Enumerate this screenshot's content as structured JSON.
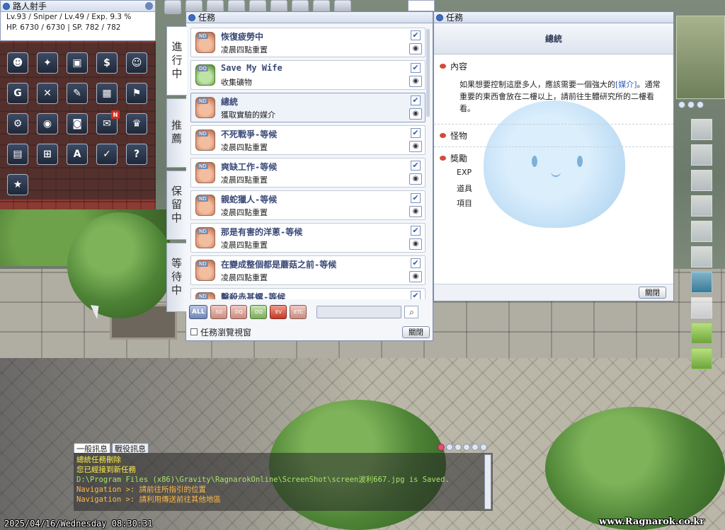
{
  "character": {
    "name": "路人射手",
    "stats_line1": "Lv.93 / Sniper / Lv.49 / Exp. 9.3 %",
    "stats_line2": "HP. 6730 / 6730 | SP. 782 / 782"
  },
  "menu": {
    "mail_badge": "N",
    "text_icon": "A",
    "items": [
      {
        "icon": "character-status-icon"
      },
      {
        "icon": "skill-tree-icon"
      },
      {
        "icon": "inventory-icon"
      },
      {
        "icon": "cash-shop-icon"
      },
      {
        "icon": "friend-add-icon"
      },
      {
        "icon": "guild-icon"
      },
      {
        "icon": "battle-icon"
      },
      {
        "icon": "quest-scroll-icon"
      },
      {
        "icon": "world-map-icon"
      },
      {
        "icon": "flag-icon"
      },
      {
        "icon": "settings-icon"
      },
      {
        "icon": "storage-bag-icon"
      },
      {
        "icon": "camera-icon"
      },
      {
        "icon": "mail-icon"
      },
      {
        "icon": "trophy-icon"
      },
      {
        "icon": "book-icon"
      },
      {
        "icon": "shop-cart-icon"
      },
      {
        "icon": "text-a-icon"
      },
      {
        "icon": "calendar-icon"
      },
      {
        "icon": "help-icon"
      },
      {
        "icon": "party-icon"
      }
    ]
  },
  "quest_window": {
    "title": "任務",
    "tabs": [
      "進行中",
      "推薦",
      "保留中",
      "等待中"
    ],
    "items": [
      {
        "type": "ND",
        "name": "恢復疲勞中",
        "sub": "凌晨四點重置",
        "checked": true
      },
      {
        "type": "DQ",
        "name": "Save My Wife",
        "sub": "收集礦物",
        "checked": true
      },
      {
        "type": "ND",
        "name": "總統",
        "sub": "獲取實驗的媒介",
        "checked": true
      },
      {
        "type": "ND",
        "name": "不死戰爭-等候",
        "sub": "凌晨四點重置",
        "checked": true
      },
      {
        "type": "ND",
        "name": "爽缺工作-等候",
        "sub": "凌晨四點重置",
        "checked": true
      },
      {
        "type": "ND",
        "name": "親蛇獵人-等候",
        "sub": "凌晨四點重置",
        "checked": true
      },
      {
        "type": "ND",
        "name": "那是有害的洋蔥-等候",
        "sub": "凌晨四點重置",
        "checked": true
      },
      {
        "type": "ND",
        "name": "在變成整個都是蘑菇之前-等候",
        "sub": "凌晨四點重置",
        "checked": true
      },
      {
        "type": "ND",
        "name": "擊殺赤甚螺-等候",
        "sub": "",
        "checked": true
      }
    ],
    "filters": [
      "ALL",
      "SD",
      "DQ",
      "DQ",
      "EV",
      "ETC"
    ],
    "browse_label": "任務瀏覽視窗",
    "close_label": "關閉"
  },
  "detail_window": {
    "title": "任務",
    "quest_name": "總統",
    "section_content": "內容",
    "content_before": "如果想要控制這麼多人，應該需要一個強大的",
    "content_link": "[媒介]",
    "content_after": "。通常重要的東西會放在二樓以上，請前往生體研究所的二樓看看。",
    "section_monster": "怪物",
    "section_reward": "獎勵",
    "rewards": [
      "EXP",
      "道具",
      "項目"
    ],
    "close_label": "關閉"
  },
  "chat": {
    "tabs": [
      "一般訊息",
      "戰役訊息"
    ],
    "lines": [
      {
        "text": "總統任務刪除",
        "color": "yellow"
      },
      {
        "text": "您已經接到新任務",
        "color": "yellow"
      },
      {
        "text": "D:\\Program Files (x86)\\Gravity\\RagnarokOnline\\ScreenShot\\screen波利667.jpg is Saved.",
        "color": "green"
      },
      {
        "text": "Navigation >: 請前往所指引的位置",
        "color": "orange"
      },
      {
        "text": "Navigation >: 請利用傳送前往其他地區",
        "color": "orange"
      }
    ]
  },
  "status": {
    "datetime": "2025/04/16/Wednesday 08:30:31",
    "watermark": "www.Ragnarok.co.kr"
  }
}
